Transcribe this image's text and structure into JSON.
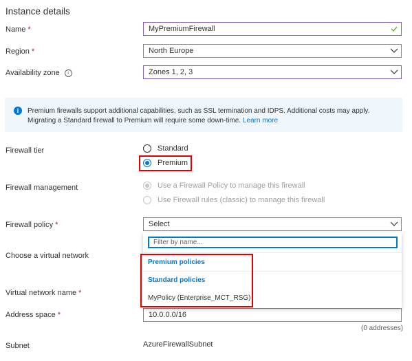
{
  "section_title": "Instance details",
  "fields": {
    "name": {
      "label": "Name",
      "value": "MyPremiumFirewall"
    },
    "region": {
      "label": "Region",
      "value": "North Europe"
    },
    "availability_zone": {
      "label": "Availability zone",
      "value": "Zones 1, 2, 3"
    }
  },
  "info_bar": {
    "text": "Premium firewalls support additional capabilities, such as SSL termination and IDPS. Additional costs may apply. Migrating a Standard firewall to Premium will require some down-time.",
    "link": "Learn more"
  },
  "firewall_tier": {
    "label": "Firewall tier",
    "options": [
      "Standard",
      "Premium"
    ],
    "selected": "Premium"
  },
  "firewall_management": {
    "label": "Firewall management",
    "options": [
      "Use a Firewall Policy to manage this firewall",
      "Use Firewall rules (classic) to manage this firewall"
    ],
    "selected": "Use a Firewall Policy to manage this firewall"
  },
  "firewall_policy": {
    "label": "Firewall policy",
    "value": "Select",
    "filter_placeholder": "Filter by name...",
    "groups": [
      "Premium policies",
      "Standard policies"
    ],
    "items": [
      "MyPolicy (Enterprise_MCT_RSG)"
    ]
  },
  "virtual_network": {
    "label": "Choose a virtual network"
  },
  "virtual_network_name": {
    "label": "Virtual network name"
  },
  "address_space": {
    "label": "Address space",
    "value": "10.0.0.0/16",
    "note": "(0 addresses)"
  },
  "subnet": {
    "label": "Subnet",
    "value": "AzureFirewallSubnet"
  },
  "colors": {
    "accent": "#0078d4",
    "highlight": "#e00000",
    "required": "#a4262c",
    "info_bg": "#eff6fc"
  }
}
